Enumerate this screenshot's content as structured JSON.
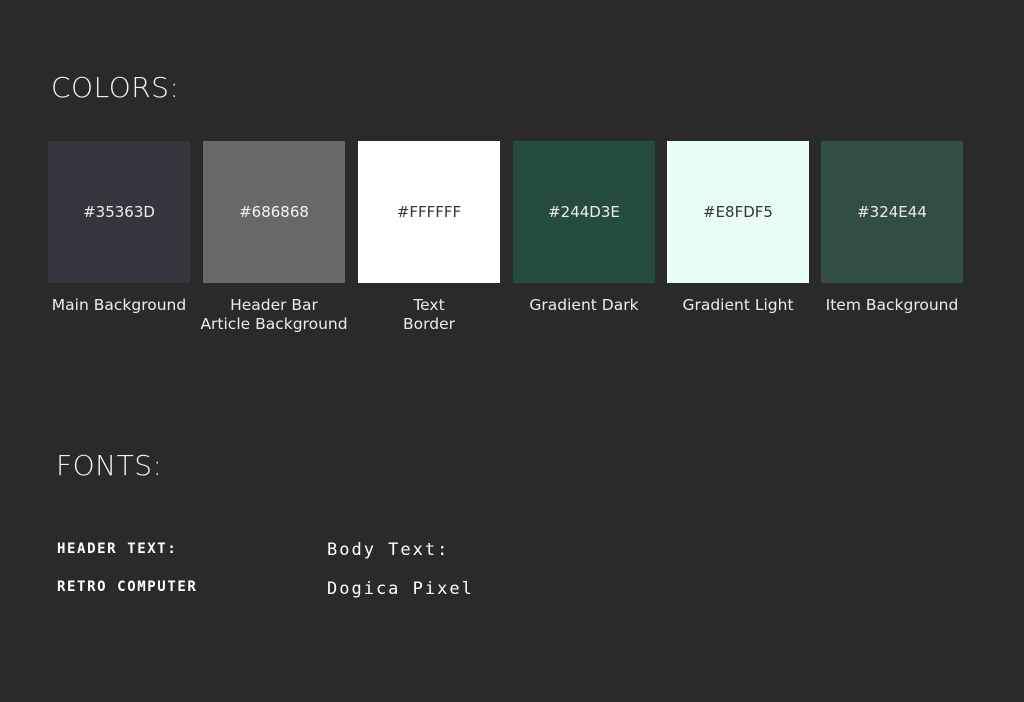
{
  "colors_title": "COLORS:",
  "fonts_title": "FONTS:",
  "swatches": [
    {
      "hex": "#35363D",
      "color": "#35363D",
      "text_color": "#ececec",
      "label_lines": [
        "Main Background"
      ]
    },
    {
      "hex": "#686868",
      "color": "#686868",
      "text_color": "#f4f4f4",
      "label_lines": [
        "Header Bar",
        "Article Background"
      ]
    },
    {
      "hex": "#FFFFFF",
      "color": "#FFFFFF",
      "text_color": "#35363D",
      "label_lines": [
        "Text",
        "Border"
      ]
    },
    {
      "hex": "#244D3E",
      "color": "#244D3E",
      "text_color": "#ececec",
      "label_lines": [
        "Gradient Dark"
      ]
    },
    {
      "hex": "#E8FDF5",
      "color": "#E8FDF5",
      "text_color": "#35363D",
      "label_lines": [
        "Gradient Light"
      ]
    },
    {
      "hex": "#324E44",
      "color": "#324E44",
      "text_color": "#ececec",
      "label_lines": [
        "Item Background"
      ]
    }
  ],
  "fonts": {
    "header_label": "HEADER TEXT:",
    "header_name": "RETRO COMPUTER",
    "body_label": "Body Text:",
    "body_name": "Dogica Pixel"
  }
}
